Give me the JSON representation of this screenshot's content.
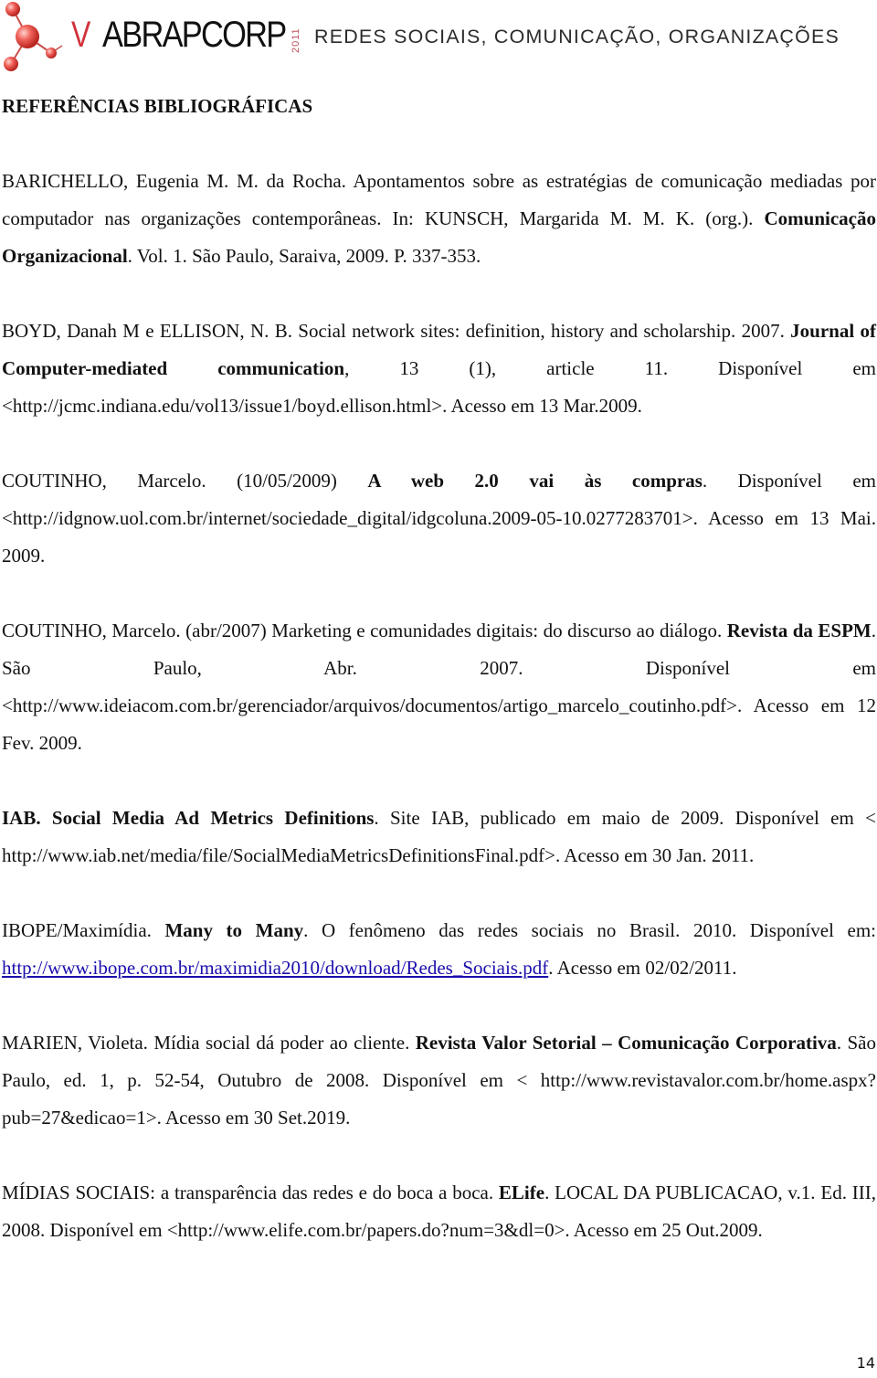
{
  "header": {
    "logo_prefix": "V",
    "logo_name": "ABRAPCORP",
    "logo_year": "2011",
    "tagline": "REDES SOCIAIS, COMUNICAÇÃO, ORGANIZAÇÕES",
    "colors": {
      "accent": "#d0323a",
      "text": "#2b2b2b"
    }
  },
  "document": {
    "heading": "REFERÊNCIAS BIBLIOGRÁFICAS",
    "references": [
      {
        "parts": [
          {
            "t": "BARICHELLO, Eugenia M. M. da Rocha. Apontamentos sobre as estratégias de comunicação mediadas por computador nas organizações contemporâneas. In: KUNSCH, Margarida M. M. K. (org.). "
          },
          {
            "t": "Comunicação Organizacional",
            "b": true
          },
          {
            "t": ". Vol. 1. São Paulo, Saraiva, 2009. P. 337-353."
          }
        ]
      },
      {
        "parts": [
          {
            "t": "BOYD, Danah M e ELLISON, N. B. Social network sites: definition, history and scholarship. 2007. "
          },
          {
            "t": "Journal of Computer-mediated communication",
            "b": true
          },
          {
            "t": ", 13 (1), article 11. Disponível em <http://jcmc.indiana.edu/vol13/issue1/boyd.ellison.html>. Acesso em 13 Mar.2009."
          }
        ]
      },
      {
        "parts": [
          {
            "t": "COUTINHO, Marcelo. (10/05/2009) "
          },
          {
            "t": "A web 2.0 vai às compras",
            "b": true
          },
          {
            "t": ". Disponível em <http://idgnow.uol.com.br/internet/sociedade_digital/idgcoluna.2009-05-10.0277283701>. Acesso em 13 Mai. 2009."
          }
        ]
      },
      {
        "parts": [
          {
            "t": "COUTINHO, Marcelo. (abr/2007) Marketing e comunidades digitais: do discurso ao diálogo. "
          },
          {
            "t": "Revista da ESPM",
            "b": true
          },
          {
            "t": ". São Paulo, Abr. 2007. Disponível em <http://www.ideiacom.com.br/gerenciador/arquivos/documentos/artigo_marcelo_coutinho.pdf>. Acesso em 12 Fev. 2009."
          }
        ]
      },
      {
        "parts": [
          {
            "t": "IAB. Social Media Ad Metrics Definitions",
            "b": true
          },
          {
            "t": ". Site IAB, publicado em maio de 2009. Disponível em < http://www.iab.net/media/file/SocialMediaMetricsDefinitionsFinal.pdf>. Acesso em 30 Jan. 2011."
          }
        ]
      },
      {
        "parts": [
          {
            "t": "IBOPE/Maximídia. "
          },
          {
            "t": "Many to Many",
            "b": true
          },
          {
            "t": ". O fenômeno das redes sociais no Brasil. 2010. Disponível em: "
          },
          {
            "t": "http://www.ibope.com.br/maximidia2010/download/Redes_Sociais.pdf",
            "link": true
          },
          {
            "t": ". Acesso em 02/02/2011."
          }
        ]
      },
      {
        "parts": [
          {
            "t": "MARIEN, Violeta. Mídia social dá poder ao cliente. "
          },
          {
            "t": "Revista Valor Setorial – Comunicação Corporativa",
            "b": true
          },
          {
            "t": ". São Paulo, ed. 1, p. 52-54, Outubro de 2008. Disponível em < http://www.revistavalor.com.br/home.aspx?pub=27&edicao=1>. Acesso em 30 Set.2019."
          }
        ]
      },
      {
        "parts": [
          {
            "t": "MÍDIAS SOCIAIS: a transparência das redes e do boca a boca. "
          },
          {
            "t": "ELife",
            "b": true
          },
          {
            "t": ". LOCAL DA PUBLICACAO, v.1. Ed. III, 2008. Disponível em <http://www.elife.com.br/papers.do?num=3&dl=0>. Acesso em 25 Out.2009."
          }
        ]
      }
    ],
    "page_number": "14"
  }
}
